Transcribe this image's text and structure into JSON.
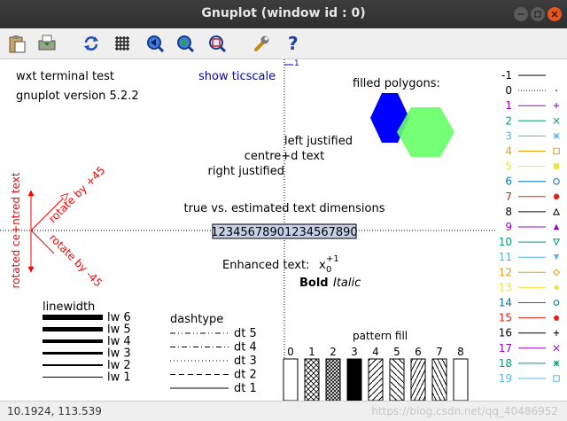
{
  "window": {
    "title": "Gnuplot (window id : 0)"
  },
  "toolbar": {
    "items": [
      {
        "name": "copy-to-clipboard",
        "icon": "clipboard-icon"
      },
      {
        "name": "print",
        "icon": "printer-icon"
      },
      {
        "name": "replot",
        "icon": "refresh-icon"
      },
      {
        "name": "toggle-grid",
        "icon": "grid-icon"
      },
      {
        "name": "previous-zoom",
        "icon": "zoom-back-icon"
      },
      {
        "name": "next-zoom",
        "icon": "zoom-forward-icon"
      },
      {
        "name": "autoscale",
        "icon": "zoom-fit-icon"
      },
      {
        "name": "preferences",
        "icon": "wrench-icon"
      },
      {
        "name": "help",
        "icon": "help-icon"
      }
    ]
  },
  "plot": {
    "header_line1": "wxt  terminal test",
    "header_line2": "gnuplot version 5.2.2",
    "show_ticscale": "show ticscale",
    "tic_label": "1",
    "filled_polygons": "filled polygons:",
    "left_justified": "left justified",
    "centred_text": "centre+d text",
    "right_justified": "right justified",
    "rotate_plus": "rotate by +45",
    "rotate_minus": "rotate by -45",
    "rotated_centred": "rotated ce+ntred text",
    "text_dimensions": "true vs. estimated text dimensions",
    "sample_string": "12345678901234567890",
    "enhanced_label": "Enhanced text:",
    "enhanced_base": "x",
    "enhanced_sub": "0",
    "enhanced_sup": "+1",
    "bold": "Bold",
    "italic": "Italic",
    "linewidth_title": "linewidth",
    "linewidths": [
      "lw 6",
      "lw 5",
      "lw 4",
      "lw 3",
      "lw 2",
      "lw 1"
    ],
    "dashtype_title": "dashtype",
    "dashtypes": [
      "dt 5",
      "dt 4",
      "dt 3",
      "dt 2",
      "dt 1"
    ],
    "pattern_title": "pattern fill",
    "patterns": [
      "0",
      "1",
      "2",
      "3",
      "4",
      "5",
      "6",
      "7",
      "8"
    ],
    "linetypes": [
      {
        "label": "-1",
        "color": "#000000",
        "marker": "none"
      },
      {
        "label": "0",
        "color": "#000000",
        "marker": "dot"
      },
      {
        "label": "1",
        "color": "#9400d3",
        "marker": "plus"
      },
      {
        "label": "2",
        "color": "#009e73",
        "marker": "cross"
      },
      {
        "label": "3",
        "color": "#56b4e9",
        "marker": "star"
      },
      {
        "label": "4",
        "color": "#e69f00",
        "marker": "box"
      },
      {
        "label": "5",
        "color": "#f0e442",
        "marker": "boxfill"
      },
      {
        "label": "6",
        "color": "#0072b2",
        "marker": "circle"
      },
      {
        "label": "7",
        "color": "#e51e10",
        "marker": "circlefill"
      },
      {
        "label": "8",
        "color": "#000000",
        "marker": "triangle"
      },
      {
        "label": "9",
        "color": "#9400d3",
        "marker": "trianglefill"
      },
      {
        "label": "10",
        "color": "#009e73",
        "marker": "invtriangle"
      },
      {
        "label": "11",
        "color": "#56b4e9",
        "marker": "invtrianglefill"
      },
      {
        "label": "12",
        "color": "#e69f00",
        "marker": "diamond"
      },
      {
        "label": "13",
        "color": "#f0e442",
        "marker": "diamondfill"
      },
      {
        "label": "14",
        "color": "#0072b2",
        "marker": "pentagon"
      },
      {
        "label": "15",
        "color": "#e51e10",
        "marker": "pentagonfill"
      },
      {
        "label": "16",
        "color": "#000000",
        "marker": "plus"
      },
      {
        "label": "17",
        "color": "#9400d3",
        "marker": "cross"
      },
      {
        "label": "18",
        "color": "#009e73",
        "marker": "star"
      },
      {
        "label": "19",
        "color": "#56b4e9",
        "marker": "box"
      }
    ],
    "colors": {
      "blue": "#0000ff",
      "green": "#66ff66",
      "red": "#ff0000",
      "ticscale": "#0000cc"
    }
  },
  "status": {
    "coords": "10.1924, 113.539",
    "watermark": "https://blog.csdn.net/qq_40486952"
  }
}
